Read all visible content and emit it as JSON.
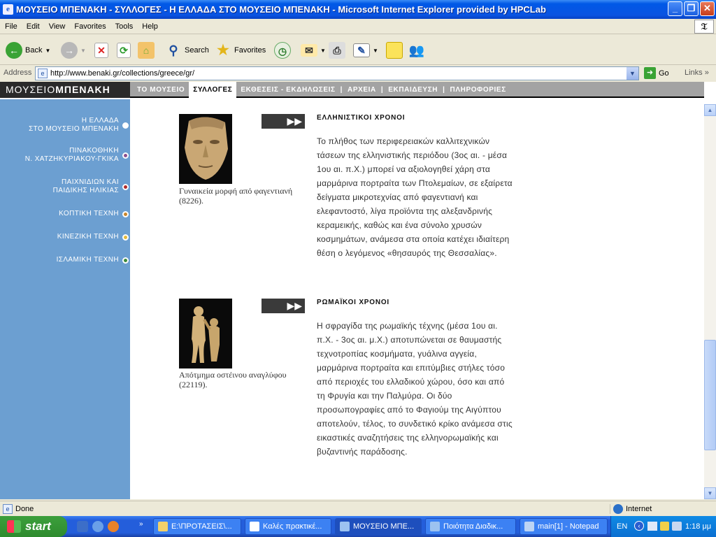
{
  "window": {
    "title": "ΜΟΥΣΕΙΟ ΜΠΕΝΑΚΗ - ΣΥΛΛΟΓΕΣ - Η ΕΛΛΑΔΑ ΣΤΟ ΜΟΥΣΕΙΟ ΜΠΕΝΑΚΗ - Microsoft Internet Explorer provided by HPCLab"
  },
  "menu": [
    "File",
    "Edit",
    "View",
    "Favorites",
    "Tools",
    "Help"
  ],
  "toolbar": {
    "back": "Back",
    "search": "Search",
    "favorites": "Favorites"
  },
  "address": {
    "label": "Address",
    "url": "http://www.benaki.gr/collections/greece/gr/",
    "go": "Go",
    "links": "Links"
  },
  "site": {
    "logo_left": "ΜΟΥΣΕΙΟ",
    "logo_right": "ΜΠΕΝΑΚΗ",
    "nav": [
      {
        "label": "ΤΟ ΜΟΥΣΕΙΟ",
        "active": false
      },
      {
        "label": "ΣΥΛΛΟΓΕΣ",
        "active": true
      },
      {
        "label": "ΕΚΘΕΣΕΙΣ - ΕΚΔΗΛΩΣΕΙΣ",
        "active": false
      },
      {
        "label": "ΑΡΧΕΙΑ",
        "active": false
      },
      {
        "label": "ΕΚΠΑΙΔΕΥΣΗ",
        "active": false
      },
      {
        "label": "ΠΛΗΡΟΦΟΡΙΕΣ",
        "active": false
      }
    ]
  },
  "sidebar": {
    "items": [
      {
        "line1": "Η ΕΛΛΑΔΑ",
        "line2": "ΣΤΟ ΜΟΥΣΕΙΟ ΜΠΕΝΑΚΗ",
        "dot": "#ffffff",
        "active": true
      },
      {
        "line1": "ΠΙΝΑΚΟΘΗΚΗ",
        "line2": "Ν. ΧΑΤΖΗΚΥΡΙΑΚΟΥ-ΓΚΙΚΑ",
        "dot": "#8a4f8f",
        "active": false
      },
      {
        "line1": "ΠΑΙΧΝΙΔΙΩΝ ΚΑΙ",
        "line2": "ΠΑΙΔΙΚΗΣ ΗΛΙΚΙΑΣ",
        "dot": "#b02a2a",
        "active": false
      },
      {
        "line1": "ΚΟΠΤΙΚΗ ΤΕΧΝΗ",
        "line2": "",
        "dot": "#c8852a",
        "active": false
      },
      {
        "line1": "ΚΙΝΕΖΙΚΗ ΤΕΧΝΗ",
        "line2": "",
        "dot": "#e5b93a",
        "active": false
      },
      {
        "line1": "ΙΣΛΑΜΙΚΗ ΤΕΧΝΗ",
        "line2": "",
        "dot": "#3c8a3a",
        "active": false
      }
    ]
  },
  "articles": [
    {
      "heading": "ΕΛΛΗΝΙΣΤΙΚΟΙ ΧΡΟΝΟΙ",
      "caption": "Γυναικεία μορφή από φαγεντιανή (8226).",
      "lines": [
        "Το πλήθος των περιφερειακών καλλιτεχνικών",
        "τάσεων της ελληνιστικής περιόδου (3ος αι. - μέσα",
        "1ου αι. π.Χ.) μπορεί να αξιολογηθεί χάρη στα",
        "μαρμάρινα πορτραίτα των Πτολεμαίων, σε εξαίρετα",
        "δείγματα μικροτεχνίας από φαγεντιανή και",
        "ελεφαντοστό, λίγα προϊόντα της αλεξανδρινής",
        "κεραμεικής, καθώς και ένα σύνολο χρυσών",
        "κοσμημάτων, ανάμεσα στα οποία κατέχει ιδιαίτερη",
        "θέση ο λεγόμενος «θησαυρός της Θεσσαλίας»."
      ]
    },
    {
      "heading": "ΡΩΜΑΪΚΟΙ ΧΡΟΝΟΙ",
      "caption": "Απότμημα οστέινου αναγλύφου (22119).",
      "lines": [
        "Η σφραγίδα της ρωμαϊκής τέχνης (μέσα 1ου αι.",
        "π.Χ. - 3ος αι. μ.Χ.) αποτυπώνεται σε θαυμαστής",
        "τεχνοτροπίας κοσμήματα, γυάλινα αγγεία,",
        "μαρμάρινα πορτραίτα και επιτύμβιες στήλες τόσο",
        "από περιοχές του ελλαδικού χώρου, όσο και από",
        "τη Φρυγία και την Παλμύρα. Οι δύο",
        "προσωπογραφίες από το Φαγιούμ της Αιγύπτου",
        "αποτελούν, τέλος, το συνδετικό κρίκο ανάμεσα στις",
        "εικαστικές αναζητήσεις της ελληνορωμαϊκής και",
        "βυζαντινής παράδοσης."
      ]
    }
  ],
  "status": {
    "text": "Done",
    "zone": "Internet"
  },
  "taskbar": {
    "start": "start",
    "tasks": [
      {
        "label": "E:\\ΠΡΟΤΑΣΕΙΣ\\...",
        "active": false
      },
      {
        "label": "Καλές πρακτικέ...",
        "active": false
      },
      {
        "label": "ΜΟΥΣΕΙΟ ΜΠΕ...",
        "active": true
      },
      {
        "label": "Ποιότητα Διαδικ...",
        "active": false
      },
      {
        "label": "main[1] - Notepad",
        "active": false
      }
    ],
    "lang": "EN",
    "clock": "1:18 μμ"
  }
}
